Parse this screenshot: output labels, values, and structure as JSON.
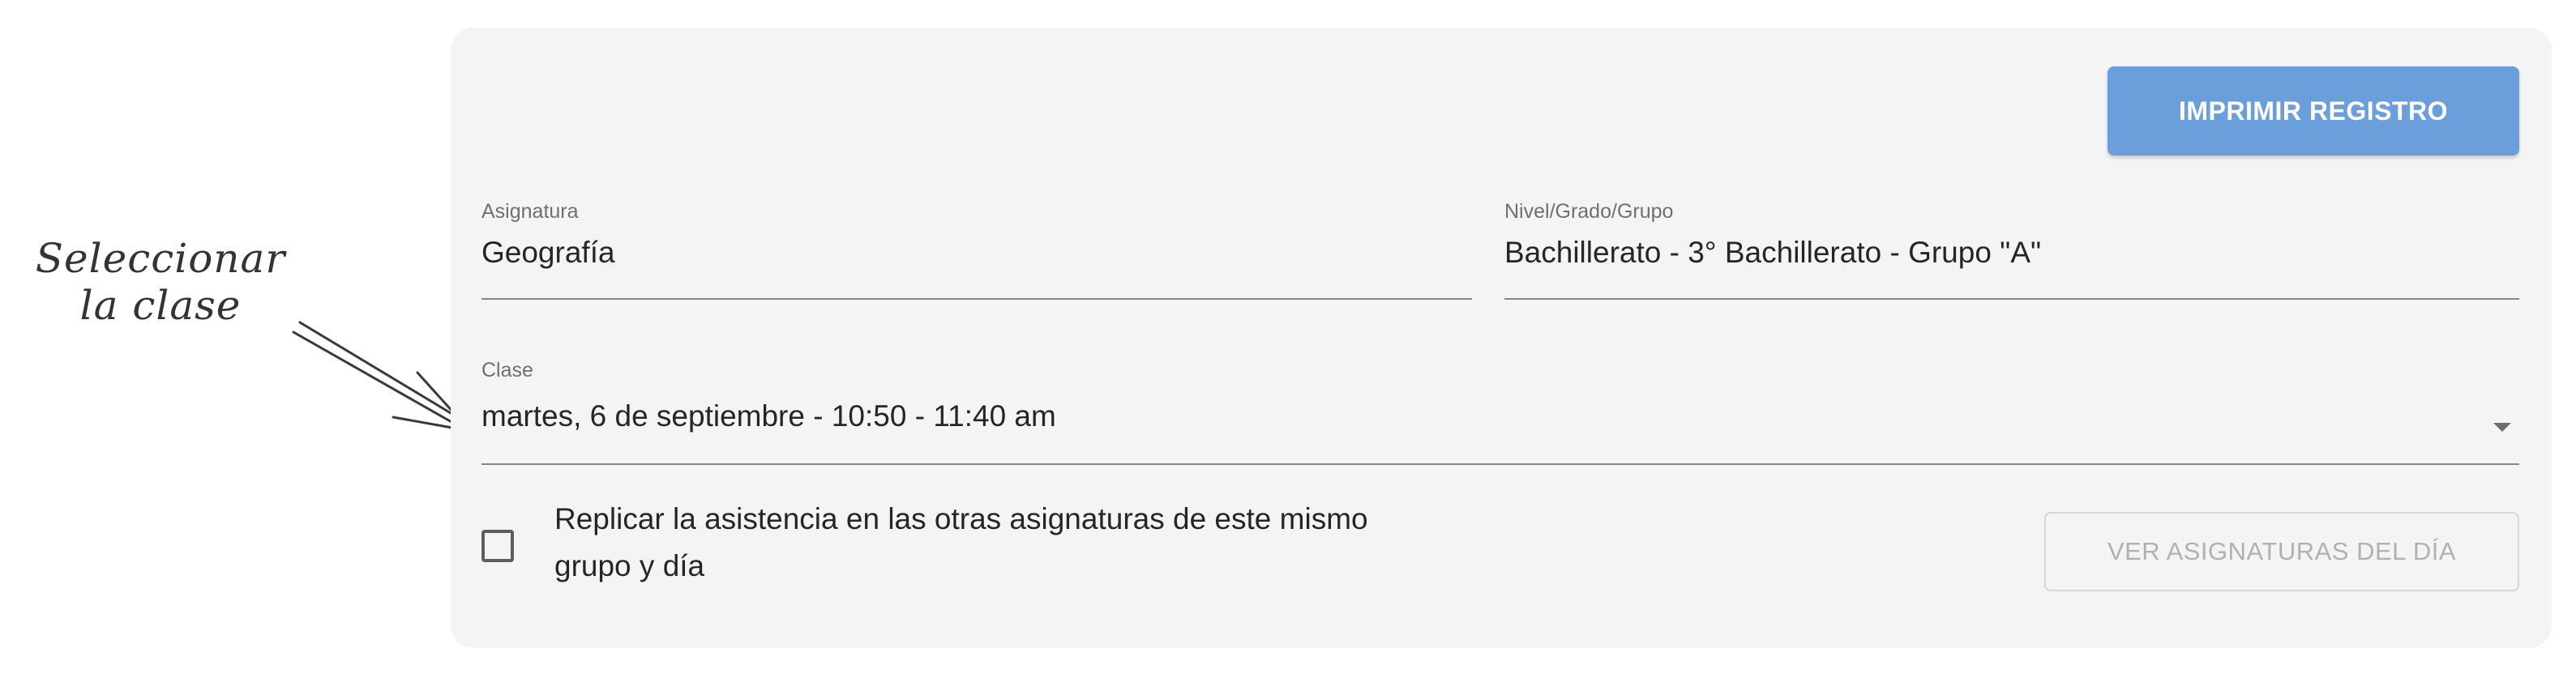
{
  "annotation": {
    "line1": "Seleccionar",
    "line2": "la clase"
  },
  "card": {
    "print_button_label": "IMPRIMIR REGISTRO",
    "asignatura": {
      "label": "Asignatura",
      "value": "Geografía"
    },
    "nivel": {
      "label": "Nivel/Grado/Grupo",
      "value": "Bachillerato - 3° Bachillerato - Grupo \"A\""
    },
    "clase": {
      "label": "Clase",
      "value": "martes, 6 de septiembre - 10:50 - 11:40 am"
    },
    "replicar": {
      "checked": false,
      "label": "Replicar la asistencia en las otras asignaturas de este mismo grupo y día"
    },
    "ver_button_label": "VER ASIGNATURAS DEL DÍA"
  },
  "colors": {
    "primary": "#6a9fdb",
    "card_background": "#f4f4f5"
  }
}
